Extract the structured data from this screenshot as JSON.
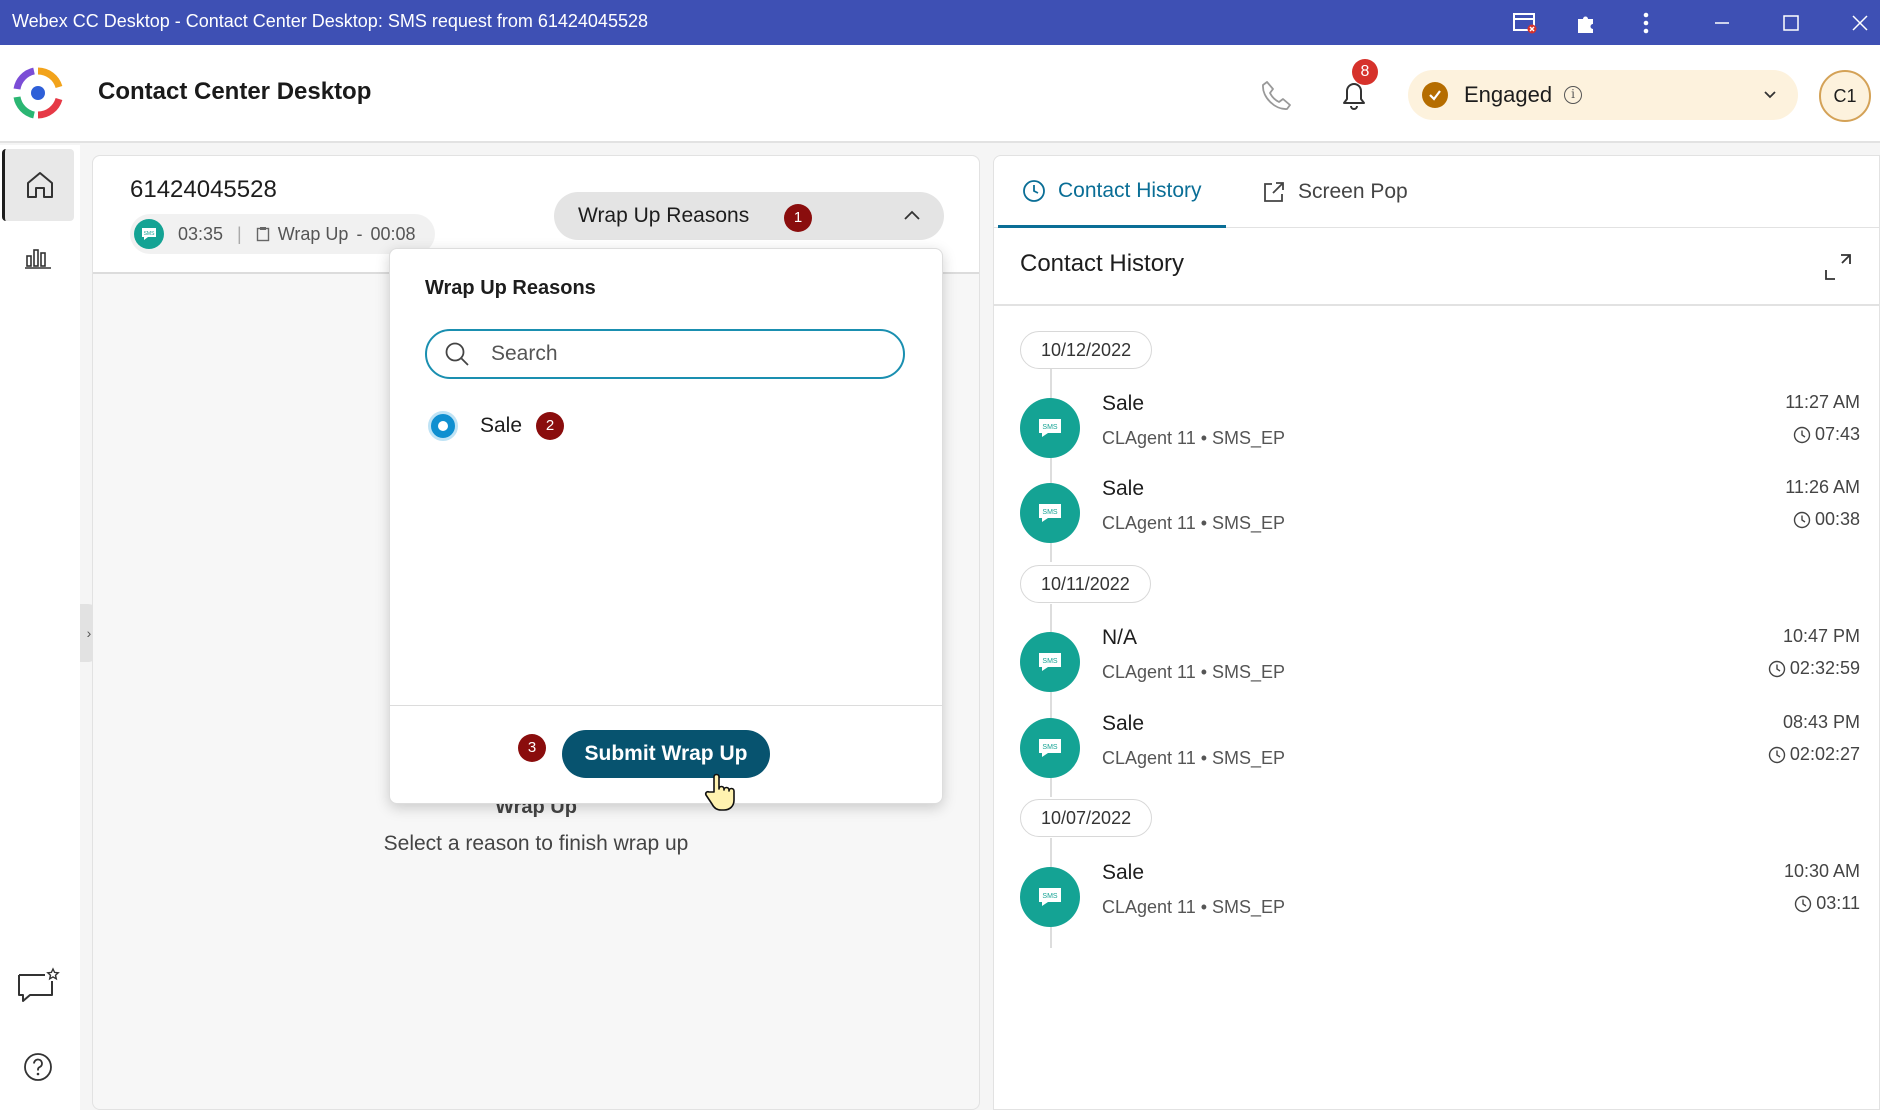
{
  "window": {
    "title": "Webex CC Desktop - Contact Center Desktop: SMS request from 61424045528"
  },
  "header": {
    "app_title": "Contact Center Desktop",
    "notification_count": "8",
    "agent_state": "Engaged",
    "info_glyph": "i",
    "avatar_initials": "C1"
  },
  "interaction": {
    "customer_number": "61424045528",
    "elapsed_time": "03:35",
    "state_label": "Wrap Up",
    "separator": "-",
    "wrapup_timer": "00:08",
    "wrapup_button_label": "Wrap Up Reasons",
    "wrapup_badge": "1",
    "empty_title": "Wrap Up",
    "empty_subtitle": "Select a reason to finish wrap up"
  },
  "wrapup_popover": {
    "title": "Wrap Up Reasons",
    "search_placeholder": "Search",
    "options": [
      {
        "label": "Sale",
        "badge": "2",
        "selected": true
      }
    ],
    "submit_badge": "3",
    "submit_label": "Submit Wrap Up"
  },
  "right_panel": {
    "tabs": [
      {
        "label": "Contact History",
        "active": true
      },
      {
        "label": "Screen Pop",
        "active": false
      }
    ],
    "section_title": "Contact History",
    "groups": [
      {
        "date": "10/12/2022",
        "items": [
          {
            "reason": "Sale",
            "detail": "CLAgent 11 • SMS_EP",
            "time": "11:27 AM",
            "duration": "07:43"
          },
          {
            "reason": "Sale",
            "detail": "CLAgent 11 • SMS_EP",
            "time": "11:26 AM",
            "duration": "00:38"
          }
        ]
      },
      {
        "date": "10/11/2022",
        "items": [
          {
            "reason": "N/A",
            "detail": "CLAgent 11 • SMS_EP",
            "time": "10:47 PM",
            "duration": "02:32:59"
          },
          {
            "reason": "Sale",
            "detail": "CLAgent 11 • SMS_EP",
            "time": "08:43 PM",
            "duration": "02:02:27"
          }
        ]
      },
      {
        "date": "10/07/2022",
        "items": [
          {
            "reason": "Sale",
            "detail": "CLAgent 11 • SMS_EP",
            "time": "10:30 AM",
            "duration": "03:11"
          }
        ]
      }
    ]
  },
  "icons": {
    "sms_badge": "SMS",
    "collapse_handle": "›"
  },
  "colors": {
    "titlebar": "#3e50b4",
    "sms_green": "#14a394",
    "primary_button": "#07536f",
    "active_tab": "#0a6e96",
    "step_badge": "#8a0d0d",
    "notification_badge": "#d6322b",
    "engaged_state": "#b56d00"
  }
}
